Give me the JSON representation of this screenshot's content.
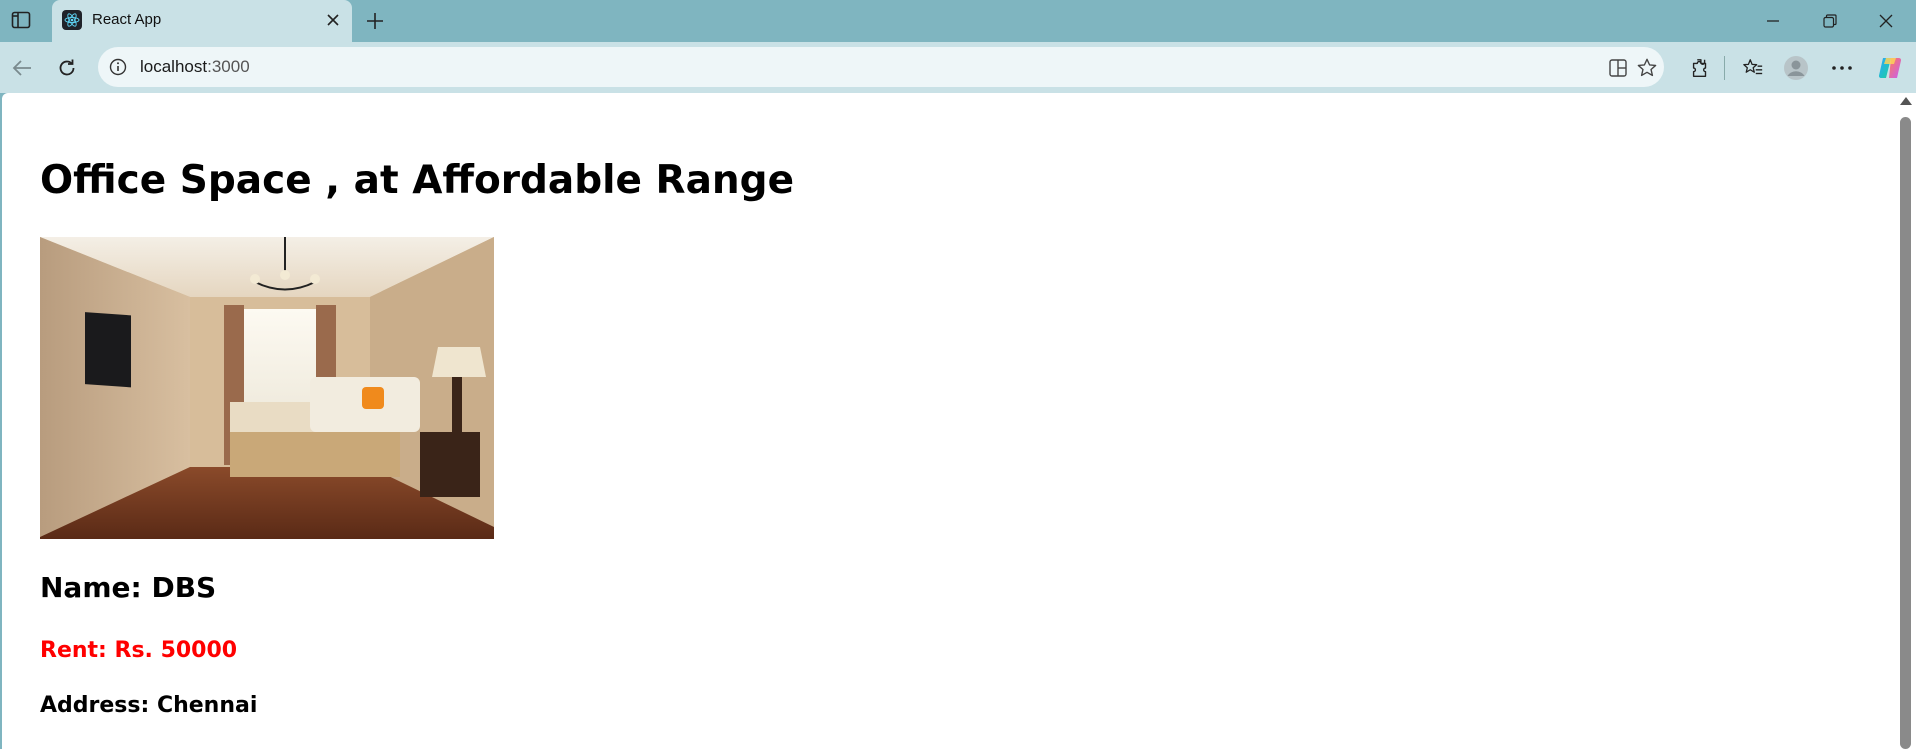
{
  "browser": {
    "tab_title": "React App",
    "url_host": "localhost",
    "url_port": ":3000"
  },
  "page": {
    "heading": "Office Space , at Affordable Range",
    "image_alt": "Office space",
    "name_label": "Name:",
    "name_value": "DBS",
    "rent_label": "Rent:",
    "rent_value": "Rs. 50000",
    "address_label": "Address:",
    "address_value": "Chennai"
  },
  "colors": {
    "frame": "#7fb5c0",
    "toolbar": "#c9e1e6",
    "rent": "#ff0000"
  }
}
